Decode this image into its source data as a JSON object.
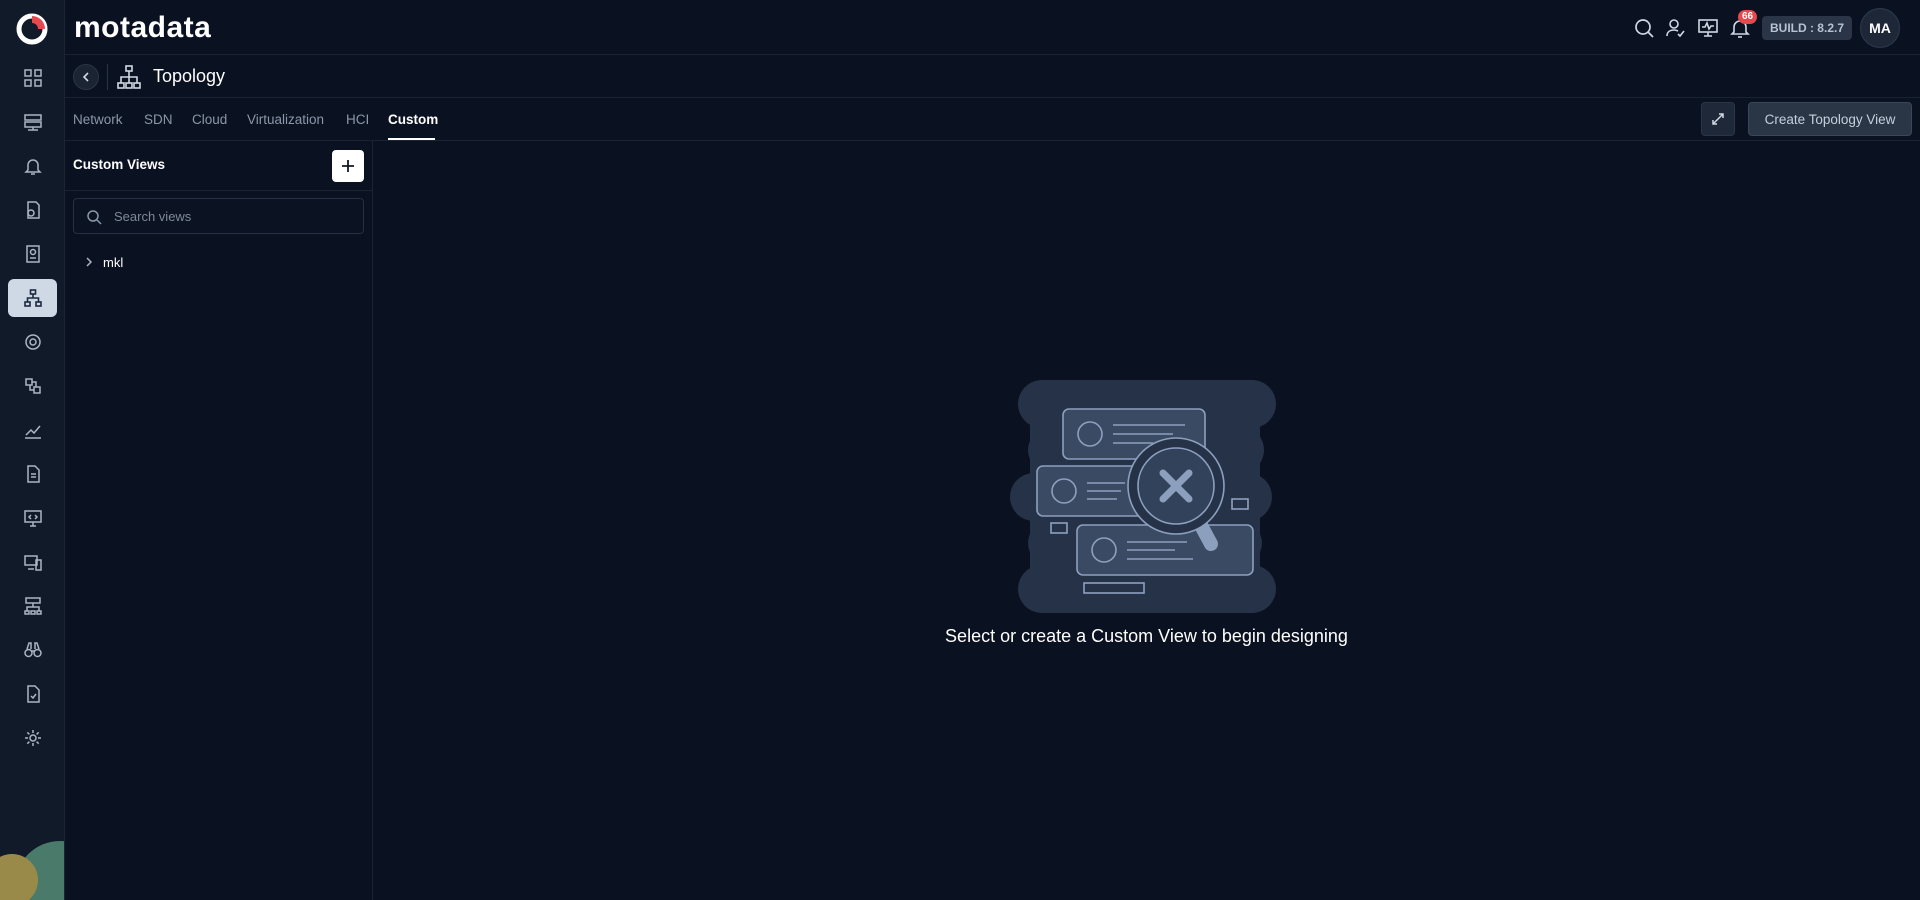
{
  "app": {
    "brand": "motadata"
  },
  "colors": {
    "background": "#0a1120",
    "rail": "#111a29",
    "accent": "#ffffff",
    "badge": "#e5484d",
    "art": "#263247"
  },
  "header": {
    "icons": [
      "search-icon",
      "user-check-icon",
      "monitor-icon",
      "bell-icon"
    ],
    "notification_count": "66",
    "build": "BUILD : 8.2.7",
    "avatar_initials": "MA"
  },
  "rail": {
    "items": [
      "dashboard-icon",
      "server-icon",
      "alert-icon",
      "metric-explorer-icon",
      "inventory-icon",
      "topology-icon",
      "aiops-icon",
      "config-icon",
      "trend-icon",
      "report-icon",
      "monitor-code-icon",
      "device-icon",
      "network-flow-icon",
      "binoculars-icon",
      "audit-icon",
      "settings-icon"
    ],
    "active": "topology-icon"
  },
  "page": {
    "title": "Topology"
  },
  "tabs": [
    {
      "label": "Network"
    },
    {
      "label": "SDN"
    },
    {
      "label": "Cloud"
    },
    {
      "label": "Virtualization"
    },
    {
      "label": "HCI"
    },
    {
      "label": "Custom"
    }
  ],
  "active_tab": "Custom",
  "actions": {
    "create_label": "Create Topology View"
  },
  "sidebar": {
    "title": "Custom Views",
    "search_placeholder": "Search views",
    "items": [
      {
        "label": "mkl"
      }
    ]
  },
  "empty_state": {
    "message": "Select or create a Custom View to begin designing"
  }
}
